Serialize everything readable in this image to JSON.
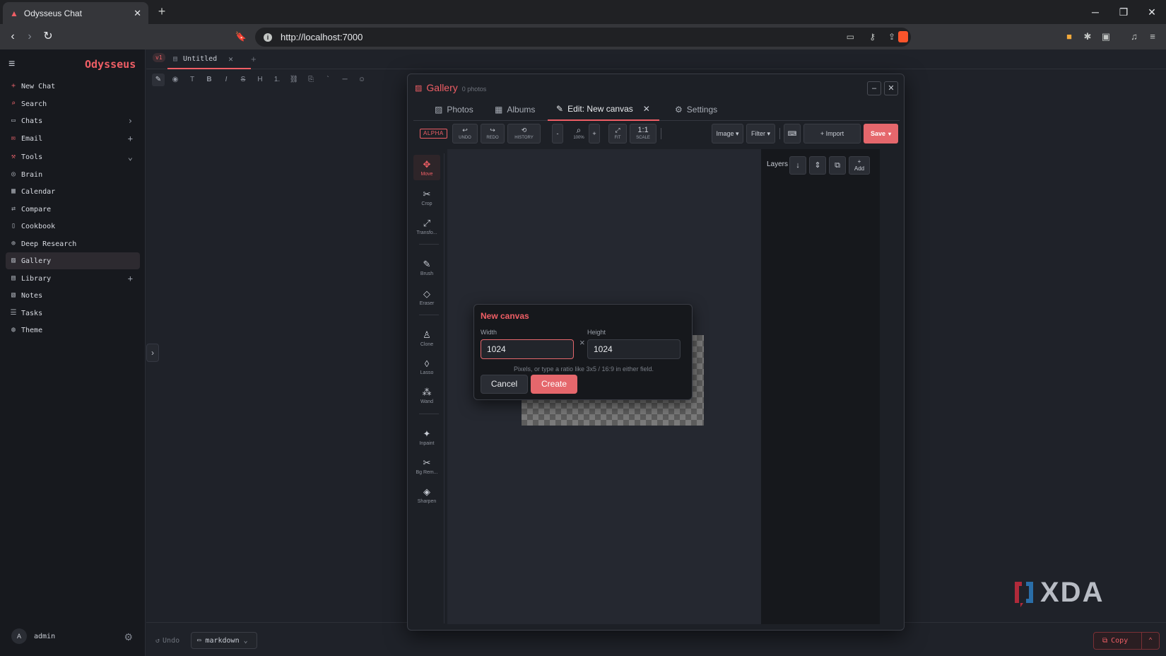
{
  "browser": {
    "tab_title": "Odysseus Chat",
    "url": "http://localhost:7000",
    "brand_color": "#ef5e65"
  },
  "sidebar": {
    "brand": "Odysseus",
    "items": [
      {
        "label": "New Chat",
        "icon": "plus-icon"
      },
      {
        "label": "Search",
        "icon": "search-icon"
      },
      {
        "label": "Chats",
        "icon": "chat-icon",
        "trail": "›"
      },
      {
        "label": "Email",
        "icon": "mail-icon",
        "trail": "+"
      },
      {
        "label": "Tools",
        "icon": "wrench-icon",
        "trail": "⌄"
      },
      {
        "label": "Brain",
        "icon": "brain-icon"
      },
      {
        "label": "Calendar",
        "icon": "calendar-icon"
      },
      {
        "label": "Compare",
        "icon": "compare-icon"
      },
      {
        "label": "Cookbook",
        "icon": "book-icon"
      },
      {
        "label": "Deep Research",
        "icon": "research-icon"
      },
      {
        "label": "Gallery",
        "icon": "image-icon",
        "active": true
      },
      {
        "label": "Library",
        "icon": "library-icon",
        "trail": "+"
      },
      {
        "label": "Notes",
        "icon": "note-icon"
      },
      {
        "label": "Tasks",
        "icon": "tasks-icon"
      },
      {
        "label": "Theme",
        "icon": "palette-icon"
      }
    ],
    "user": {
      "initial": "A",
      "name": "admin"
    }
  },
  "editor": {
    "version_badge": "v1",
    "doc_tab": "Untitled",
    "undo_label": "Undo",
    "mode": "markdown",
    "copy_label": "Copy"
  },
  "gallery": {
    "title": "Gallery",
    "count": "0 photos",
    "tabs": [
      "Photos",
      "Albums",
      "Edit: New canvas",
      "Settings"
    ],
    "toolbar": {
      "alpha": "ALPHA",
      "undo": "UNDO",
      "redo": "REDO",
      "history": "HISTORY",
      "zoom_out": "-",
      "zoom": "100%",
      "zoom_in": "+",
      "fit": "FIT",
      "scale_main": "1:1",
      "scale": "SCALE",
      "image": "Image ▾",
      "filter": "Filter ▾",
      "import": "+ Import",
      "save": "Save"
    },
    "tools": [
      "Move",
      "Crop",
      "Transfo...",
      "Brush",
      "Eraser",
      "Clone",
      "Lasso",
      "Wand",
      "Inpaint",
      "Bg Rem...",
      "Sharpen"
    ],
    "layers": {
      "title": "Layers",
      "add": "Add"
    }
  },
  "new_canvas": {
    "title": "New canvas",
    "width_label": "Width",
    "width_value": "1024",
    "height_label": "Height",
    "height_value": "1024",
    "times": "×",
    "hint": "Pixels, or type a ratio like 3x5 / 16:9 in either field.",
    "cancel": "Cancel",
    "create": "Create"
  },
  "watermark": "XDA"
}
